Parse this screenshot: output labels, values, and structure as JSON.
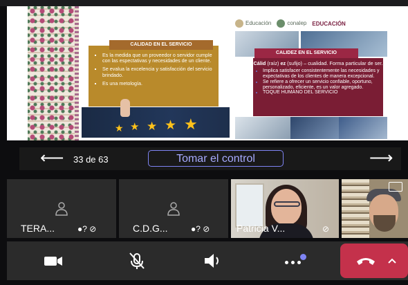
{
  "slide": {
    "logos": [
      "Educación",
      "conalep",
      "EDUCACIÓN"
    ],
    "left_box": {
      "title": "CALIDAD EN EL SERVICIO",
      "bullets": [
        "Es la medida que un proveedor o servidor cumple con las espectativas y necesidades de un cliente.",
        "Se evalua la excelencia y satisfacción del servicio brindado.",
        "Es una metología."
      ]
    },
    "right_box": {
      "title": "CALIDEZ EN EL SERVICIO",
      "lead_bold": "Cálid",
      "lead_mid": " (raíz) ",
      "lead_bold2": "ez",
      "lead_rest": " (sufijo) – cualidad. Forma particular de ser.",
      "bullets": [
        "Implica satisfacer consistentemente las necesidades y expectativas de los clientes de manera excepcional.",
        "Se refiere a ofrecer un servicio confiable, oportuno, personalizado, eficiente, es un valor agregado.",
        "TOQUE HUMANO DEL SERVICIO"
      ]
    }
  },
  "nav": {
    "counter": "33 de 63",
    "take_control": "Tomar el control",
    "prev_icon": "arrow-left-icon",
    "next_icon": "arrow-right-icon"
  },
  "participants": [
    {
      "name": "TERA...",
      "avatar": "person-icon"
    },
    {
      "name": "C.D.G...",
      "avatar": "person-icon"
    },
    {
      "name": "Patricia V..."
    },
    {
      "name": ""
    }
  ],
  "controls": [
    "camera-icon",
    "mic-off-icon",
    "speaker-icon",
    "more-icon",
    "hang-up-icon"
  ],
  "colors": {
    "gold": "#b98a2b",
    "maroon": "#7a1d34",
    "accent": "#7f85f5",
    "leave_red": "#c4314b"
  }
}
